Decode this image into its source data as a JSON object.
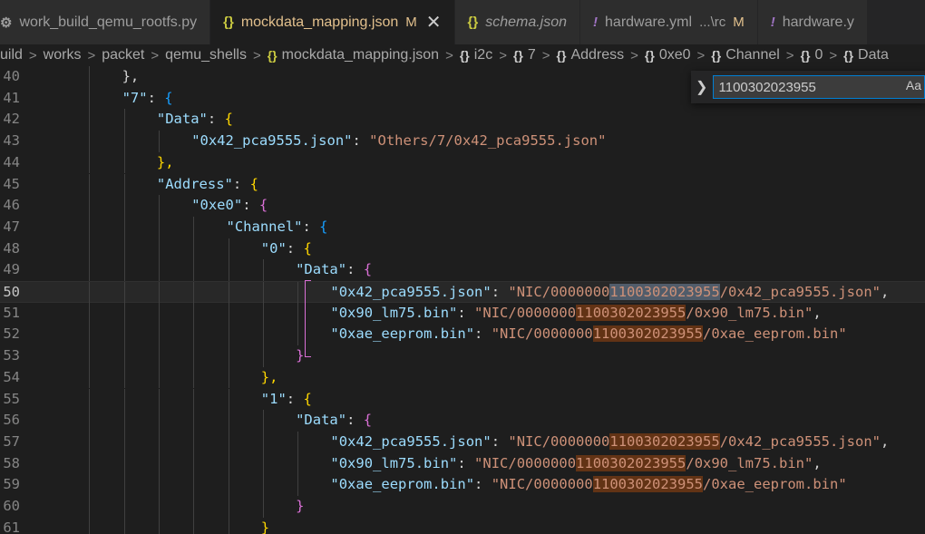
{
  "tabs": [
    {
      "icon": "gear",
      "label": "work_build_qemu_rootfs.py",
      "desc": "",
      "mod": "",
      "active": false,
      "italic": false
    },
    {
      "icon": "braces",
      "label": "mockdata_mapping.json",
      "desc": "",
      "mod": "M",
      "active": true,
      "italic": false
    },
    {
      "icon": "braces",
      "label": "schema.json",
      "desc": "",
      "mod": "",
      "active": false,
      "italic": true
    },
    {
      "icon": "bang",
      "label": "hardware.yml",
      "desc": "...\\rc",
      "mod": "M",
      "active": false,
      "italic": false
    },
    {
      "icon": "bang",
      "label": "hardware.y",
      "desc": "",
      "mod": "",
      "active": false,
      "italic": false
    }
  ],
  "tab_close_glyph": "✕",
  "breadcrumb": [
    {
      "icon": "",
      "label": "uild"
    },
    {
      "icon": "",
      "label": "works"
    },
    {
      "icon": "",
      "label": "packet"
    },
    {
      "icon": "",
      "label": "qemu_shells"
    },
    {
      "icon": "json",
      "label": "mockdata_mapping.json"
    },
    {
      "icon": "obj",
      "label": "i2c"
    },
    {
      "icon": "obj",
      "label": "7"
    },
    {
      "icon": "obj",
      "label": "Address"
    },
    {
      "icon": "obj",
      "label": "0xe0"
    },
    {
      "icon": "obj",
      "label": "Channel"
    },
    {
      "icon": "obj",
      "label": "0"
    },
    {
      "icon": "obj",
      "label": "Data"
    }
  ],
  "find_widget": {
    "query": "1100302023955",
    "match_case_label": "Aa"
  },
  "current_line": 50,
  "lines": [
    {
      "n": 40,
      "indent": 2,
      "t": [
        [
          "},",
          "p1"
        ]
      ]
    },
    {
      "n": 41,
      "indent": 2,
      "t": [
        [
          "\"7\"",
          "k"
        ],
        [
          ": ",
          "p1"
        ],
        [
          "{",
          "pb"
        ]
      ]
    },
    {
      "n": 42,
      "indent": 3,
      "t": [
        [
          "\"Data\"",
          "k"
        ],
        [
          ": ",
          "p1"
        ],
        [
          "{",
          "py"
        ]
      ]
    },
    {
      "n": 43,
      "indent": 4,
      "t": [
        [
          "\"0x42_pca9555.json\"",
          "k"
        ],
        [
          ": ",
          "p1"
        ],
        [
          "\"Others/7/0x42_pca9555.json\"",
          "s"
        ]
      ]
    },
    {
      "n": 44,
      "indent": 3,
      "t": [
        [
          "},",
          "py"
        ]
      ]
    },
    {
      "n": 45,
      "indent": 3,
      "t": [
        [
          "\"Address\"",
          "k"
        ],
        [
          ": ",
          "p1"
        ],
        [
          "{",
          "py"
        ]
      ]
    },
    {
      "n": 46,
      "indent": 4,
      "t": [
        [
          "\"0xe0\"",
          "k"
        ],
        [
          ": ",
          "p1"
        ],
        [
          "{",
          "pm"
        ]
      ]
    },
    {
      "n": 47,
      "indent": 5,
      "t": [
        [
          "\"Channel\"",
          "k"
        ],
        [
          ": ",
          "p1"
        ],
        [
          "{",
          "pb"
        ]
      ]
    },
    {
      "n": 48,
      "indent": 6,
      "t": [
        [
          "\"0\"",
          "k"
        ],
        [
          ": ",
          "p1"
        ],
        [
          "{",
          "py"
        ]
      ]
    },
    {
      "n": 49,
      "indent": 7,
      "t": [
        [
          "\"Data\"",
          "k"
        ],
        [
          ": ",
          "p1"
        ],
        [
          "{",
          "pm"
        ]
      ]
    },
    {
      "n": 50,
      "indent": 8,
      "t": [
        [
          "\"0x42_pca9555.json\"",
          "k"
        ],
        [
          ": ",
          "p1"
        ],
        [
          "\"NIC/0000000",
          "s"
        ],
        [
          "1100302023955",
          "s hl cur"
        ],
        [
          "/0x42_pca9555.json\"",
          "s"
        ],
        [
          ",",
          "p1"
        ]
      ]
    },
    {
      "n": 51,
      "indent": 8,
      "t": [
        [
          "\"0x90_lm75.bin\"",
          "k"
        ],
        [
          ": ",
          "p1"
        ],
        [
          "\"NIC/0000000",
          "s"
        ],
        [
          "1100302023955",
          "s hl"
        ],
        [
          "/0x90_lm75.bin\"",
          "s"
        ],
        [
          ",",
          "p1"
        ]
      ]
    },
    {
      "n": 52,
      "indent": 8,
      "t": [
        [
          "\"0xae_eeprom.bin\"",
          "k"
        ],
        [
          ": ",
          "p1"
        ],
        [
          "\"NIC/0000000",
          "s"
        ],
        [
          "1100302023955",
          "s hl"
        ],
        [
          "/0xae_eeprom.bin\"",
          "s"
        ]
      ]
    },
    {
      "n": 53,
      "indent": 7,
      "t": [
        [
          "}",
          "pm"
        ]
      ]
    },
    {
      "n": 54,
      "indent": 6,
      "t": [
        [
          "},",
          "py"
        ]
      ]
    },
    {
      "n": 55,
      "indent": 6,
      "t": [
        [
          "\"1\"",
          "k"
        ],
        [
          ": ",
          "p1"
        ],
        [
          "{",
          "py"
        ]
      ]
    },
    {
      "n": 56,
      "indent": 7,
      "t": [
        [
          "\"Data\"",
          "k"
        ],
        [
          ": ",
          "p1"
        ],
        [
          "{",
          "pm"
        ]
      ]
    },
    {
      "n": 57,
      "indent": 8,
      "t": [
        [
          "\"0x42_pca9555.json\"",
          "k"
        ],
        [
          ": ",
          "p1"
        ],
        [
          "\"NIC/0000000",
          "s"
        ],
        [
          "1100302023955",
          "s hl"
        ],
        [
          "/0x42_pca9555.json\"",
          "s"
        ],
        [
          ",",
          "p1"
        ]
      ]
    },
    {
      "n": 58,
      "indent": 8,
      "t": [
        [
          "\"0x90_lm75.bin\"",
          "k"
        ],
        [
          ": ",
          "p1"
        ],
        [
          "\"NIC/0000000",
          "s"
        ],
        [
          "1100302023955",
          "s hl"
        ],
        [
          "/0x90_lm75.bin\"",
          "s"
        ],
        [
          ",",
          "p1"
        ]
      ]
    },
    {
      "n": 59,
      "indent": 8,
      "t": [
        [
          "\"0xae_eeprom.bin\"",
          "k"
        ],
        [
          ": ",
          "p1"
        ],
        [
          "\"NIC/0000000",
          "s"
        ],
        [
          "1100302023955",
          "s hl"
        ],
        [
          "/0xae_eeprom.bin\"",
          "s"
        ]
      ]
    },
    {
      "n": 60,
      "indent": 7,
      "t": [
        [
          "}",
          "pm"
        ]
      ]
    },
    {
      "n": 61,
      "indent": 6,
      "t": [
        [
          "}",
          "py"
        ]
      ]
    }
  ]
}
